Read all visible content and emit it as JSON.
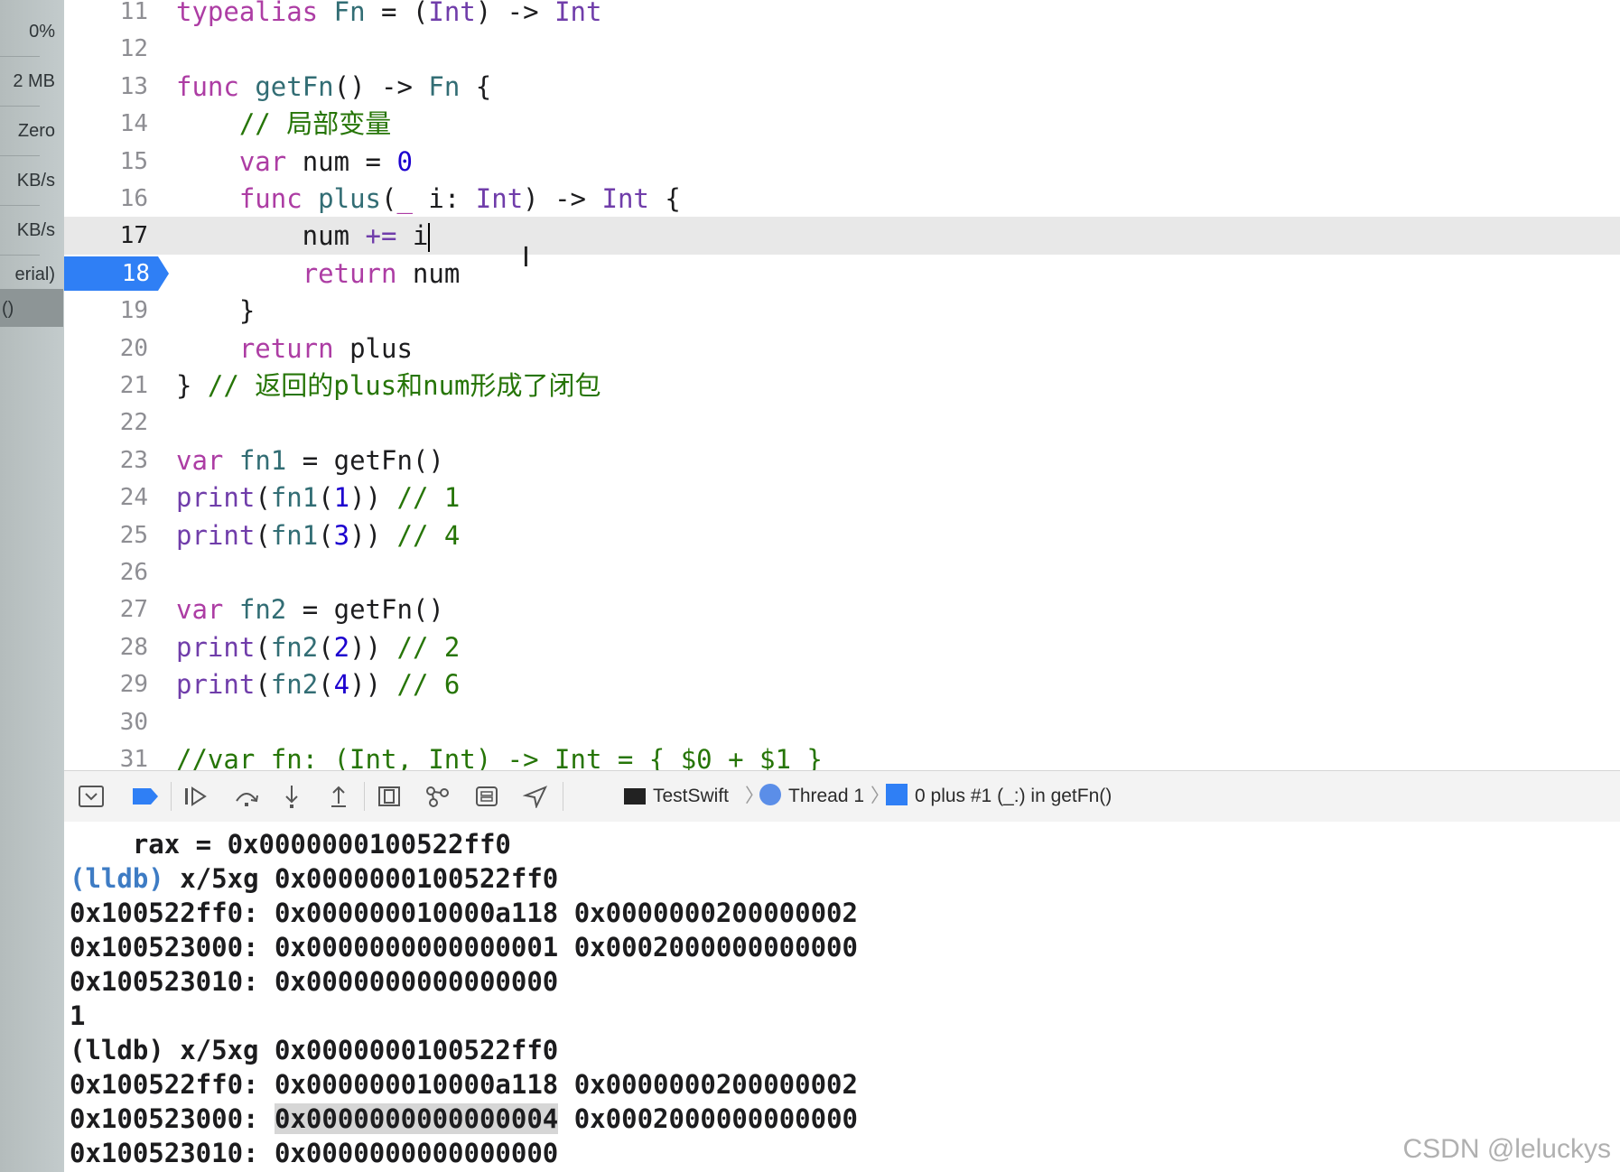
{
  "left_strip": {
    "items": [
      "0%",
      "2 MB",
      "Zero",
      "KB/s",
      "KB/s",
      "erial)",
      "()"
    ]
  },
  "editor": {
    "current_line": "17",
    "breakpoint_line": "18",
    "lines": [
      {
        "n": "11",
        "tokens": [
          {
            "t": "typealias",
            "c": "kw"
          },
          {
            "t": " ",
            "c": "pl"
          },
          {
            "t": "Fn",
            "c": "fn"
          },
          {
            "t": " = (",
            "c": "pl"
          },
          {
            "t": "Int",
            "c": "ty"
          },
          {
            "t": ") -> ",
            "c": "pl"
          },
          {
            "t": "Int",
            "c": "ty"
          }
        ]
      },
      {
        "n": "12",
        "tokens": []
      },
      {
        "n": "13",
        "tokens": [
          {
            "t": "func",
            "c": "kw"
          },
          {
            "t": " ",
            "c": "pl"
          },
          {
            "t": "getFn",
            "c": "fn"
          },
          {
            "t": "() -> ",
            "c": "pl"
          },
          {
            "t": "Fn",
            "c": "fn"
          },
          {
            "t": " {",
            "c": "pl"
          }
        ]
      },
      {
        "n": "14",
        "tokens": [
          {
            "t": "    ",
            "c": "pl"
          },
          {
            "t": "// 局部变量",
            "c": "cm"
          }
        ]
      },
      {
        "n": "15",
        "tokens": [
          {
            "t": "    ",
            "c": "pl"
          },
          {
            "t": "var",
            "c": "kw"
          },
          {
            "t": " num = ",
            "c": "pl"
          },
          {
            "t": "0",
            "c": "nm"
          }
        ]
      },
      {
        "n": "16",
        "tokens": [
          {
            "t": "    ",
            "c": "pl"
          },
          {
            "t": "func",
            "c": "kw"
          },
          {
            "t": " ",
            "c": "pl"
          },
          {
            "t": "plus",
            "c": "fn"
          },
          {
            "t": "(",
            "c": "pl"
          },
          {
            "t": "_",
            "c": "kw"
          },
          {
            "t": " i: ",
            "c": "pl"
          },
          {
            "t": "Int",
            "c": "ty"
          },
          {
            "t": ") -> ",
            "c": "pl"
          },
          {
            "t": "Int",
            "c": "ty"
          },
          {
            "t": " {",
            "c": "pl"
          }
        ]
      },
      {
        "n": "17",
        "tokens": [
          {
            "t": "        num ",
            "c": "pl"
          },
          {
            "t": "+=",
            "c": "ty"
          },
          {
            "t": " i",
            "c": "pl"
          }
        ]
      },
      {
        "n": "18",
        "tokens": [
          {
            "t": "        ",
            "c": "pl"
          },
          {
            "t": "return",
            "c": "kw"
          },
          {
            "t": " num",
            "c": "pl"
          }
        ]
      },
      {
        "n": "19",
        "tokens": [
          {
            "t": "    }",
            "c": "pl"
          }
        ]
      },
      {
        "n": "20",
        "tokens": [
          {
            "t": "    ",
            "c": "pl"
          },
          {
            "t": "return",
            "c": "kw"
          },
          {
            "t": " plus",
            "c": "pl"
          }
        ]
      },
      {
        "n": "21",
        "tokens": [
          {
            "t": "} ",
            "c": "pl"
          },
          {
            "t": "// 返回的plus和num形成了闭包",
            "c": "cm"
          }
        ]
      },
      {
        "n": "22",
        "tokens": []
      },
      {
        "n": "23",
        "tokens": [
          {
            "t": "var",
            "c": "kw"
          },
          {
            "t": " ",
            "c": "pl"
          },
          {
            "t": "fn1",
            "c": "fn"
          },
          {
            "t": " = getFn()",
            "c": "pl"
          }
        ]
      },
      {
        "n": "24",
        "tokens": [
          {
            "t": "print",
            "c": "ty"
          },
          {
            "t": "(",
            "c": "pl"
          },
          {
            "t": "fn1",
            "c": "fn"
          },
          {
            "t": "(",
            "c": "pl"
          },
          {
            "t": "1",
            "c": "nm"
          },
          {
            "t": ")) ",
            "c": "pl"
          },
          {
            "t": "// 1",
            "c": "cm"
          }
        ]
      },
      {
        "n": "25",
        "tokens": [
          {
            "t": "print",
            "c": "ty"
          },
          {
            "t": "(",
            "c": "pl"
          },
          {
            "t": "fn1",
            "c": "fn"
          },
          {
            "t": "(",
            "c": "pl"
          },
          {
            "t": "3",
            "c": "nm"
          },
          {
            "t": ")) ",
            "c": "pl"
          },
          {
            "t": "// 4",
            "c": "cm"
          }
        ]
      },
      {
        "n": "26",
        "tokens": []
      },
      {
        "n": "27",
        "tokens": [
          {
            "t": "var",
            "c": "kw"
          },
          {
            "t": " ",
            "c": "pl"
          },
          {
            "t": "fn2",
            "c": "fn"
          },
          {
            "t": " = getFn()",
            "c": "pl"
          }
        ]
      },
      {
        "n": "28",
        "tokens": [
          {
            "t": "print",
            "c": "ty"
          },
          {
            "t": "(",
            "c": "pl"
          },
          {
            "t": "fn2",
            "c": "fn"
          },
          {
            "t": "(",
            "c": "pl"
          },
          {
            "t": "2",
            "c": "nm"
          },
          {
            "t": ")) ",
            "c": "pl"
          },
          {
            "t": "// 2",
            "c": "cm"
          }
        ]
      },
      {
        "n": "29",
        "tokens": [
          {
            "t": "print",
            "c": "ty"
          },
          {
            "t": "(",
            "c": "pl"
          },
          {
            "t": "fn2",
            "c": "fn"
          },
          {
            "t": "(",
            "c": "pl"
          },
          {
            "t": "4",
            "c": "nm"
          },
          {
            "t": ")) ",
            "c": "pl"
          },
          {
            "t": "// 6",
            "c": "cm"
          }
        ]
      },
      {
        "n": "30",
        "tokens": []
      },
      {
        "n": "31",
        "tokens": [
          {
            "t": "//var fn: (Int, Int) -> Int = { $0 + $1 }",
            "c": "cm"
          }
        ]
      }
    ]
  },
  "debug_bar": {
    "icons": [
      "hide-debug-area-icon",
      "breakpoints-toggle-icon",
      "continue-icon",
      "step-over-icon",
      "step-into-icon",
      "step-out-icon",
      "view-hierarchy-icon",
      "memory-graph-icon",
      "environment-overrides-icon",
      "simulate-location-icon"
    ],
    "breadcrumb": {
      "target": "TestSwift",
      "thread": "Thread 1",
      "frame": "0 plus #1 (_:) in getFn()"
    }
  },
  "console": {
    "lines": [
      {
        "segments": [
          {
            "t": "    rax = 0x0000000100522ff0",
            "s": ""
          }
        ]
      },
      {
        "segments": [
          {
            "t": "(lldb)",
            "s": "blue"
          },
          {
            "t": " x/5xg 0x0000000100522ff0",
            "s": ""
          }
        ]
      },
      {
        "segments": [
          {
            "t": "0x100522ff0: 0x000000010000a118 0x0000000200000002",
            "s": ""
          }
        ]
      },
      {
        "segments": [
          {
            "t": "0x100523000: 0x0000000000000001 0x0002000000000000",
            "s": ""
          }
        ]
      },
      {
        "segments": [
          {
            "t": "0x100523010: 0x0000000000000000",
            "s": ""
          }
        ]
      },
      {
        "segments": [
          {
            "t": "1",
            "s": ""
          }
        ]
      },
      {
        "segments": [
          {
            "t": "(lldb) x/5xg 0x0000000100522ff0",
            "s": ""
          }
        ]
      },
      {
        "segments": [
          {
            "t": "0x100522ff0: 0x000000010000a118 0x0000000200000002",
            "s": ""
          }
        ]
      },
      {
        "segments": [
          {
            "t": "0x100523000: ",
            "s": ""
          },
          {
            "t": "0x0000000000000004",
            "s": "hl"
          },
          {
            "t": " 0x0002000000000000",
            "s": ""
          }
        ]
      },
      {
        "segments": [
          {
            "t": "0x100523010: 0x0000000000000000",
            "s": ""
          }
        ]
      }
    ]
  },
  "watermark": "CSDN @leluckys",
  "colors": {
    "keyword": "#ad3da4",
    "type": "#703daa",
    "function": "#326d74",
    "comment": "#267507",
    "number": "#1c00cf",
    "breakpoint": "#2f7ff5",
    "lldb_prompt": "#3e7cc4"
  }
}
